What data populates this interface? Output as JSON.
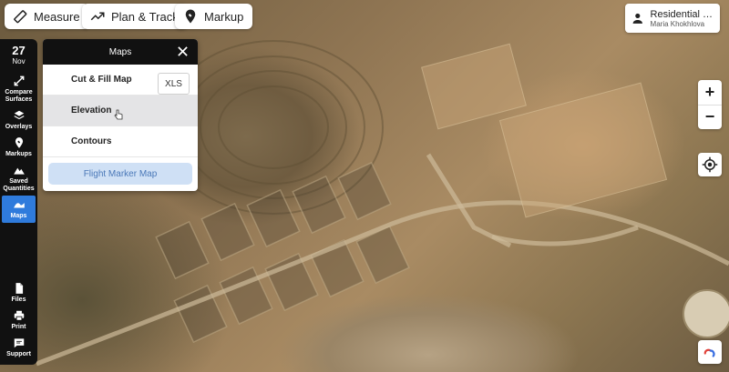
{
  "toolbar": {
    "measure_label": "Measure",
    "plan_track_label": "Plan & Track",
    "markup_label": "Markup"
  },
  "user": {
    "project_name": "Residential C...",
    "user_name": "Maria Khokhlova"
  },
  "sidebar": {
    "date_day": "27",
    "date_month": "Nov",
    "items": [
      {
        "label": "Compare Surfaces",
        "icon": "compare-icon"
      },
      {
        "label": "Overlays",
        "icon": "layers-icon"
      },
      {
        "label": "Markups",
        "icon": "markup-pin-icon"
      },
      {
        "label": "Saved Quantities",
        "icon": "mountain-icon"
      },
      {
        "label": "Maps",
        "icon": "maps-icon",
        "active": true
      },
      {
        "label": "Files",
        "icon": "file-icon"
      },
      {
        "label": "Print",
        "icon": "printer-icon"
      },
      {
        "label": "Support",
        "icon": "chat-icon"
      }
    ],
    "active_color": "#2f7bdc"
  },
  "maps_panel": {
    "title": "Maps",
    "rows": [
      {
        "label": "Cut & Fill Map"
      },
      {
        "label": "Elevation",
        "hovered": true
      },
      {
        "label": "Contours"
      }
    ],
    "xls_label": "XLS",
    "flight_marker_label": "Flight Marker Map"
  },
  "map_controls": {
    "zoom_in": "+",
    "zoom_out": "−"
  }
}
